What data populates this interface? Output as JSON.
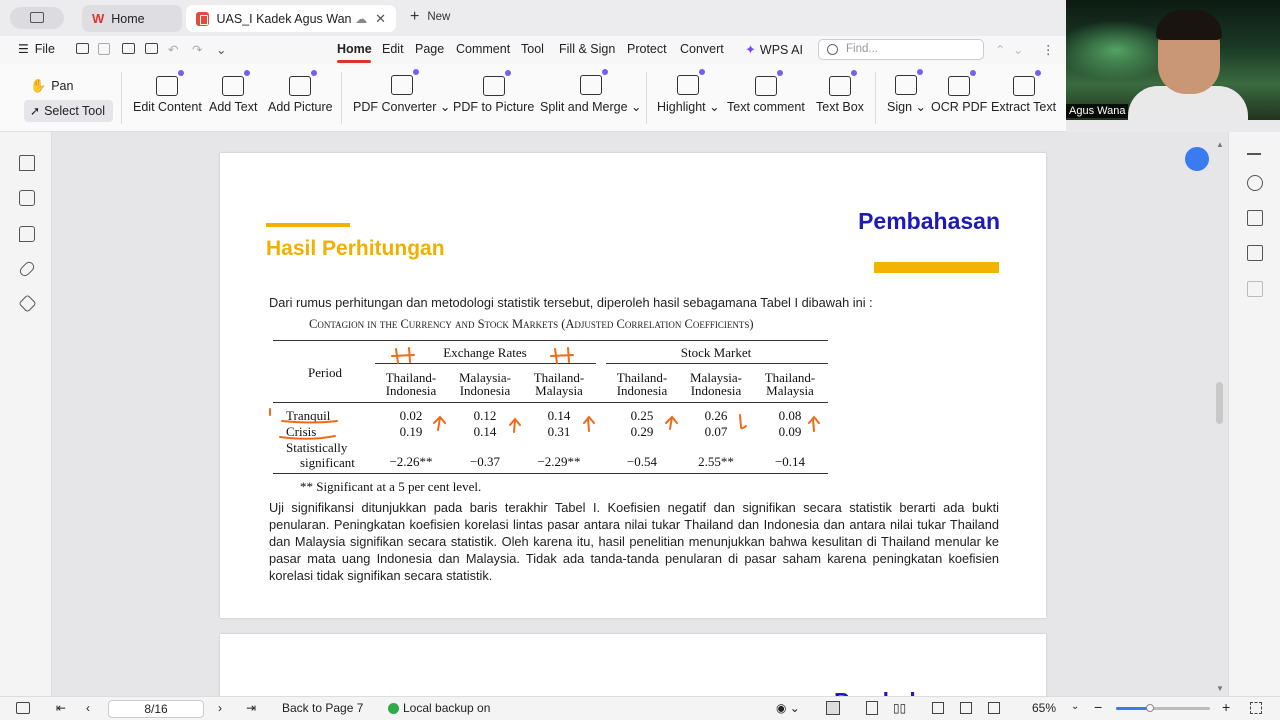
{
  "tabs": {
    "home_label": "Home",
    "doc_label": "UAS_I Kadek Agus Wana",
    "new_label": "New"
  },
  "menubar": {
    "file": "File",
    "items": [
      "Home",
      "Edit",
      "Page",
      "Comment",
      "Tool",
      "Fill & Sign",
      "Protect",
      "Convert"
    ],
    "wps_ai": "WPS AI",
    "find_placeholder": "Find..."
  },
  "ribbon": {
    "pan": "Pan",
    "select_tool": "Select Tool",
    "buttons": [
      "Edit Content",
      "Add Text",
      "Add Picture",
      "PDF Converter",
      "PDF to Picture",
      "Split and Merge",
      "Highlight",
      "Text comment",
      "Text Box",
      "Sign",
      "OCR PDF",
      "Extract Text"
    ]
  },
  "document": {
    "heading_right": "Pembahasan",
    "heading_left": "Hasil Perhitungan",
    "intro": "Dari rumus perhitungan dan metodologi statistik tersebut, diperoleh hasil sebagamana Tabel I dibawah ini :",
    "table_caption": "Contagion in the Currency and Stock Markets (Adjusted Correlation Coefficients)",
    "table": {
      "period_header": "Period",
      "group1": "Exchange Rates",
      "group2": "Stock Market",
      "col1": [
        "Thailand-",
        "Indonesia"
      ],
      "col2": [
        "Malaysia-",
        "Indonesia"
      ],
      "col3": [
        "Thailand-",
        "Malaysia"
      ],
      "col4": [
        "Thailand-",
        "Indonesia"
      ],
      "col5": [
        "Malaysia-",
        "Indonesia"
      ],
      "col6": [
        "Thailand-",
        "Malaysia"
      ],
      "row_tranquil": "Tranquil",
      "row_crisis": "Crisis",
      "row_stat1": "Statistically",
      "row_stat2": "significant",
      "tranquil_values": [
        "0.02",
        "0.12",
        "0.14",
        "0.25",
        "0.26",
        "0.08"
      ],
      "crisis_values": [
        "0.19",
        "0.14",
        "0.31",
        "0.29",
        "0.07",
        "0.09"
      ],
      "significant_values": [
        "−2.26**",
        "−0.37",
        "−2.29**",
        "−0.54",
        "2.55**",
        "−0.14"
      ]
    },
    "footnote": "**  Significant at a 5 per cent level.",
    "paragraph": "Uji signifikansi ditunjukkan pada baris terakhir Tabel I. Koefisien negatif dan signifikan secara statistik berarti ada bukti penularan. Peningkatan koefisien korelasi lintas pasar antara nilai tukar Thailand dan Indonesia dan antara nilai tukar Thailand dan Malaysia signifikan secara statistik. Oleh karena itu, hasil penelitian menunjukkan bahwa kesulitan di Thailand menular ke pasar mata uang Indonesia dan Malaysia. Tidak ada tanda-tanda penularan di pasar saham karena peningkatan koefisien korelasi tidak signifikan secara statistik.",
    "page2_heading": "Pembahasan"
  },
  "statusbar": {
    "page_indicator": "8/16",
    "back_to_page": "Back to Page 7",
    "backup": "Local backup on",
    "zoom": "65%"
  },
  "webcam": {
    "name": "Agus Wana"
  },
  "colors": {
    "accent_red": "#d33333",
    "heading_blue": "#1d1ab8",
    "heading_gold": "#f0b000",
    "annotation_orange": "#f06a1a"
  }
}
